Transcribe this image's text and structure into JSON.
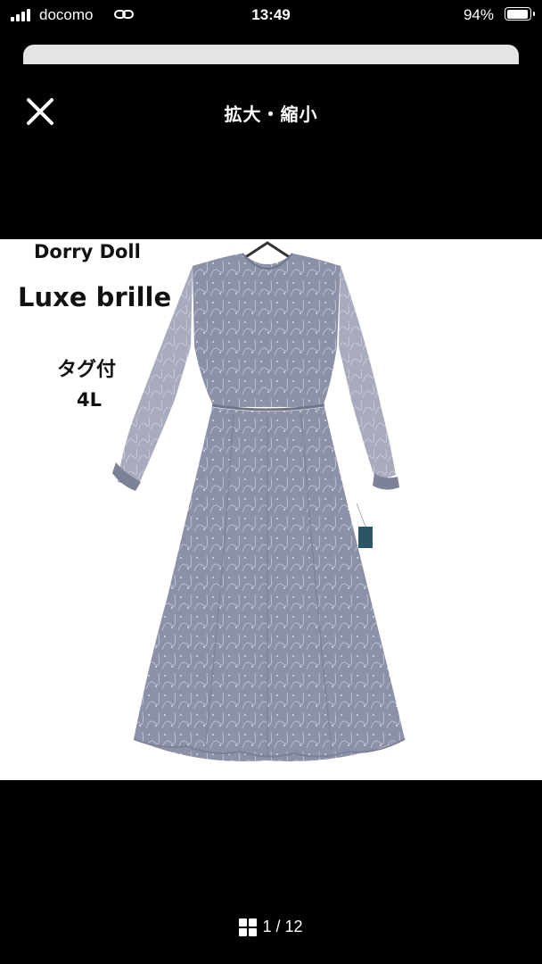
{
  "status_bar": {
    "carrier": "docomo",
    "time": "13:49",
    "battery": "94%",
    "battery_level": 0.94
  },
  "header": {
    "title": "拡大・縮小",
    "close_icon": "close-icon"
  },
  "image": {
    "brand": "Dorry Doll",
    "line": "Luxe brille",
    "tag": "タグ付",
    "size": "4L",
    "dress_color": "#8a8fa6"
  },
  "pager": {
    "text": "1 / 12",
    "icon": "grid-icon"
  }
}
